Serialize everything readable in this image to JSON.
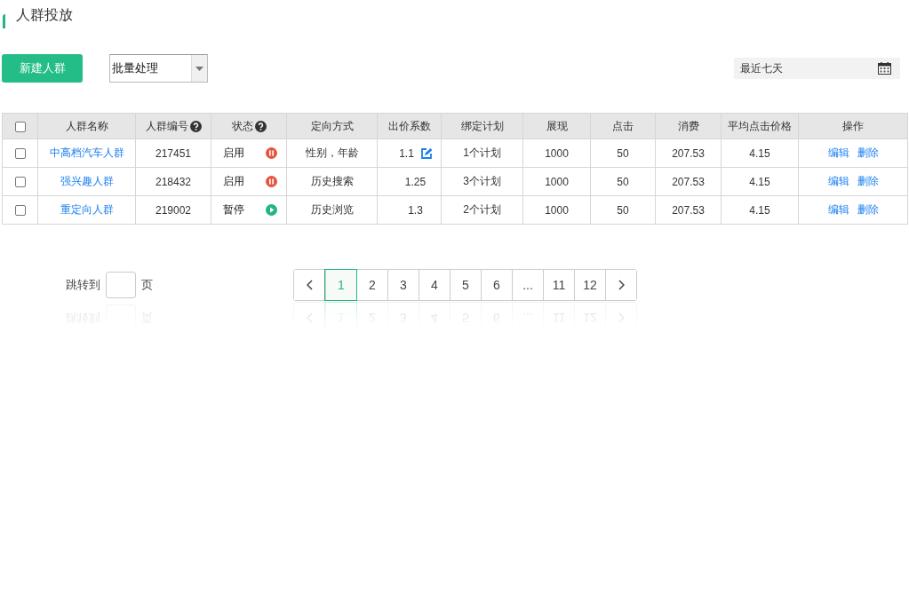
{
  "page_title": "人群投放",
  "toolbar": {
    "new_button": "新建人群",
    "batch_select": {
      "value": "批量处理"
    },
    "date_range": {
      "value": "最近七天"
    }
  },
  "table": {
    "select_all": {
      "checked": false
    },
    "columns": [
      {
        "label": "人群名称",
        "help": false
      },
      {
        "label": "人群编号",
        "help": true
      },
      {
        "label": "状态",
        "help": true
      },
      {
        "label": "定向方式",
        "help": false
      },
      {
        "label": "出价系数",
        "help": false
      },
      {
        "label": "绑定计划",
        "help": false
      },
      {
        "label": "展现",
        "help": false
      },
      {
        "label": "点击",
        "help": false
      },
      {
        "label": "消费",
        "help": false
      },
      {
        "label": "平均点击价格",
        "help": false
      },
      {
        "label": "操作",
        "help": false
      }
    ],
    "rows": [
      {
        "checked": false,
        "name": "中高档汽车人群",
        "id": "217451",
        "status": "启用",
        "active": true,
        "targeting": "性别，年龄",
        "bid": "1.1",
        "bid_editable": true,
        "plans": "1个计划",
        "impressions": "1000",
        "clicks": "50",
        "cost": "207.53",
        "avg_cpc": "4.15",
        "actions": [
          "编辑",
          "删除"
        ]
      },
      {
        "checked": false,
        "name": "强兴趣人群",
        "id": "218432",
        "status": "启用",
        "active": true,
        "targeting": "历史搜索",
        "bid": "1.25",
        "bid_editable": false,
        "plans": "3个计划",
        "impressions": "1000",
        "clicks": "50",
        "cost": "207.53",
        "avg_cpc": "4.15",
        "actions": [
          "编辑",
          "删除"
        ]
      },
      {
        "checked": false,
        "name": "重定向人群",
        "id": "219002",
        "status": "暂停",
        "active": false,
        "targeting": "历史浏览",
        "bid": "1.3",
        "bid_editable": false,
        "plans": "2个计划",
        "impressions": "1000",
        "clicks": "50",
        "cost": "207.53",
        "avg_cpc": "4.15",
        "actions": [
          "编辑",
          "删除"
        ]
      }
    ]
  },
  "pagination": {
    "jump_label": "跳转到",
    "jump_suffix": "页",
    "pages": [
      {
        "label": "1",
        "selected": true
      },
      {
        "label": "2",
        "selected": false
      },
      {
        "label": "3",
        "selected": false
      },
      {
        "label": "4",
        "selected": false
      },
      {
        "label": "5",
        "selected": false
      },
      {
        "label": "6",
        "selected": false
      },
      {
        "label": "...",
        "selected": false
      },
      {
        "label": "11",
        "selected": false
      },
      {
        "label": "12",
        "selected": false
      }
    ]
  }
}
